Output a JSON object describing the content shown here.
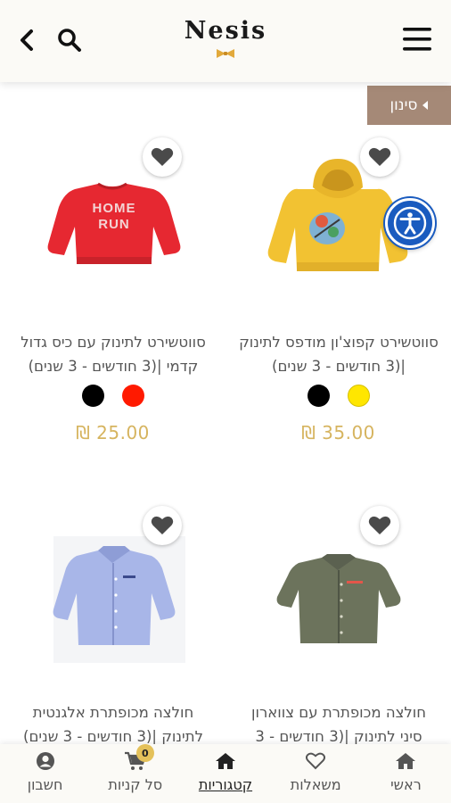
{
  "header": {
    "logo": "Nesis",
    "icons": {
      "back": "chevron-left-icon",
      "search": "search-icon",
      "menu": "hamburger-menu-icon"
    }
  },
  "filter": {
    "label": "סינון"
  },
  "products": [
    {
      "title": "סווטשירט קפוצ'ון מודפס לתינוק |(3 חודשים - 3 שנים)",
      "price": "₪ 35.00",
      "colors": [
        "#ffe600",
        "#000000"
      ]
    },
    {
      "title": "סווטשירט לתינוק עם כיס גדול קדמי |(3 חודשים - 3 שנים)",
      "price": "₪ 25.00",
      "colors": [
        "#ff1a00",
        "#000000"
      ]
    },
    {
      "title": "חולצה מכופתרת עם צווארון סיני לתינוק |(3 חודשים - 3",
      "price": "",
      "colors": []
    },
    {
      "title": "חולצה מכופתרת אלגנטית לתינוק |(3 חודשים - 3 שנים)",
      "price": "",
      "colors": []
    }
  ],
  "nav": {
    "items": [
      {
        "label": "ראשי",
        "icon": "home-icon"
      },
      {
        "label": "משאלות",
        "icon": "heart-icon"
      },
      {
        "label": "קטגוריות",
        "icon": "home-icon"
      },
      {
        "label": "סל קניות",
        "icon": "cart-icon",
        "badge": "0"
      },
      {
        "label": "חשבון",
        "icon": "user-icon"
      }
    ]
  },
  "colors": {
    "accent": "#d6b45f",
    "filter_bg": "#a58977",
    "a11y": "#1a5bbf"
  }
}
